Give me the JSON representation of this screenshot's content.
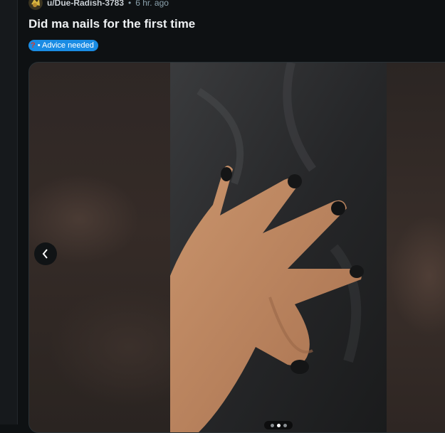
{
  "post": {
    "username": "u/Due-Radish-3783",
    "separator": "•",
    "time_ago": "6 hr. ago",
    "title": "Did ma nails for the first time",
    "flair": {
      "icon": "question-mark-icon",
      "label": "• Advice needed",
      "color": "#1a8ce4"
    }
  },
  "gallery": {
    "image_subject": "hand-with-black-nail-polish",
    "controls": [
      "previous-image-button"
    ],
    "indicator_count": 3,
    "active_index": 1
  }
}
